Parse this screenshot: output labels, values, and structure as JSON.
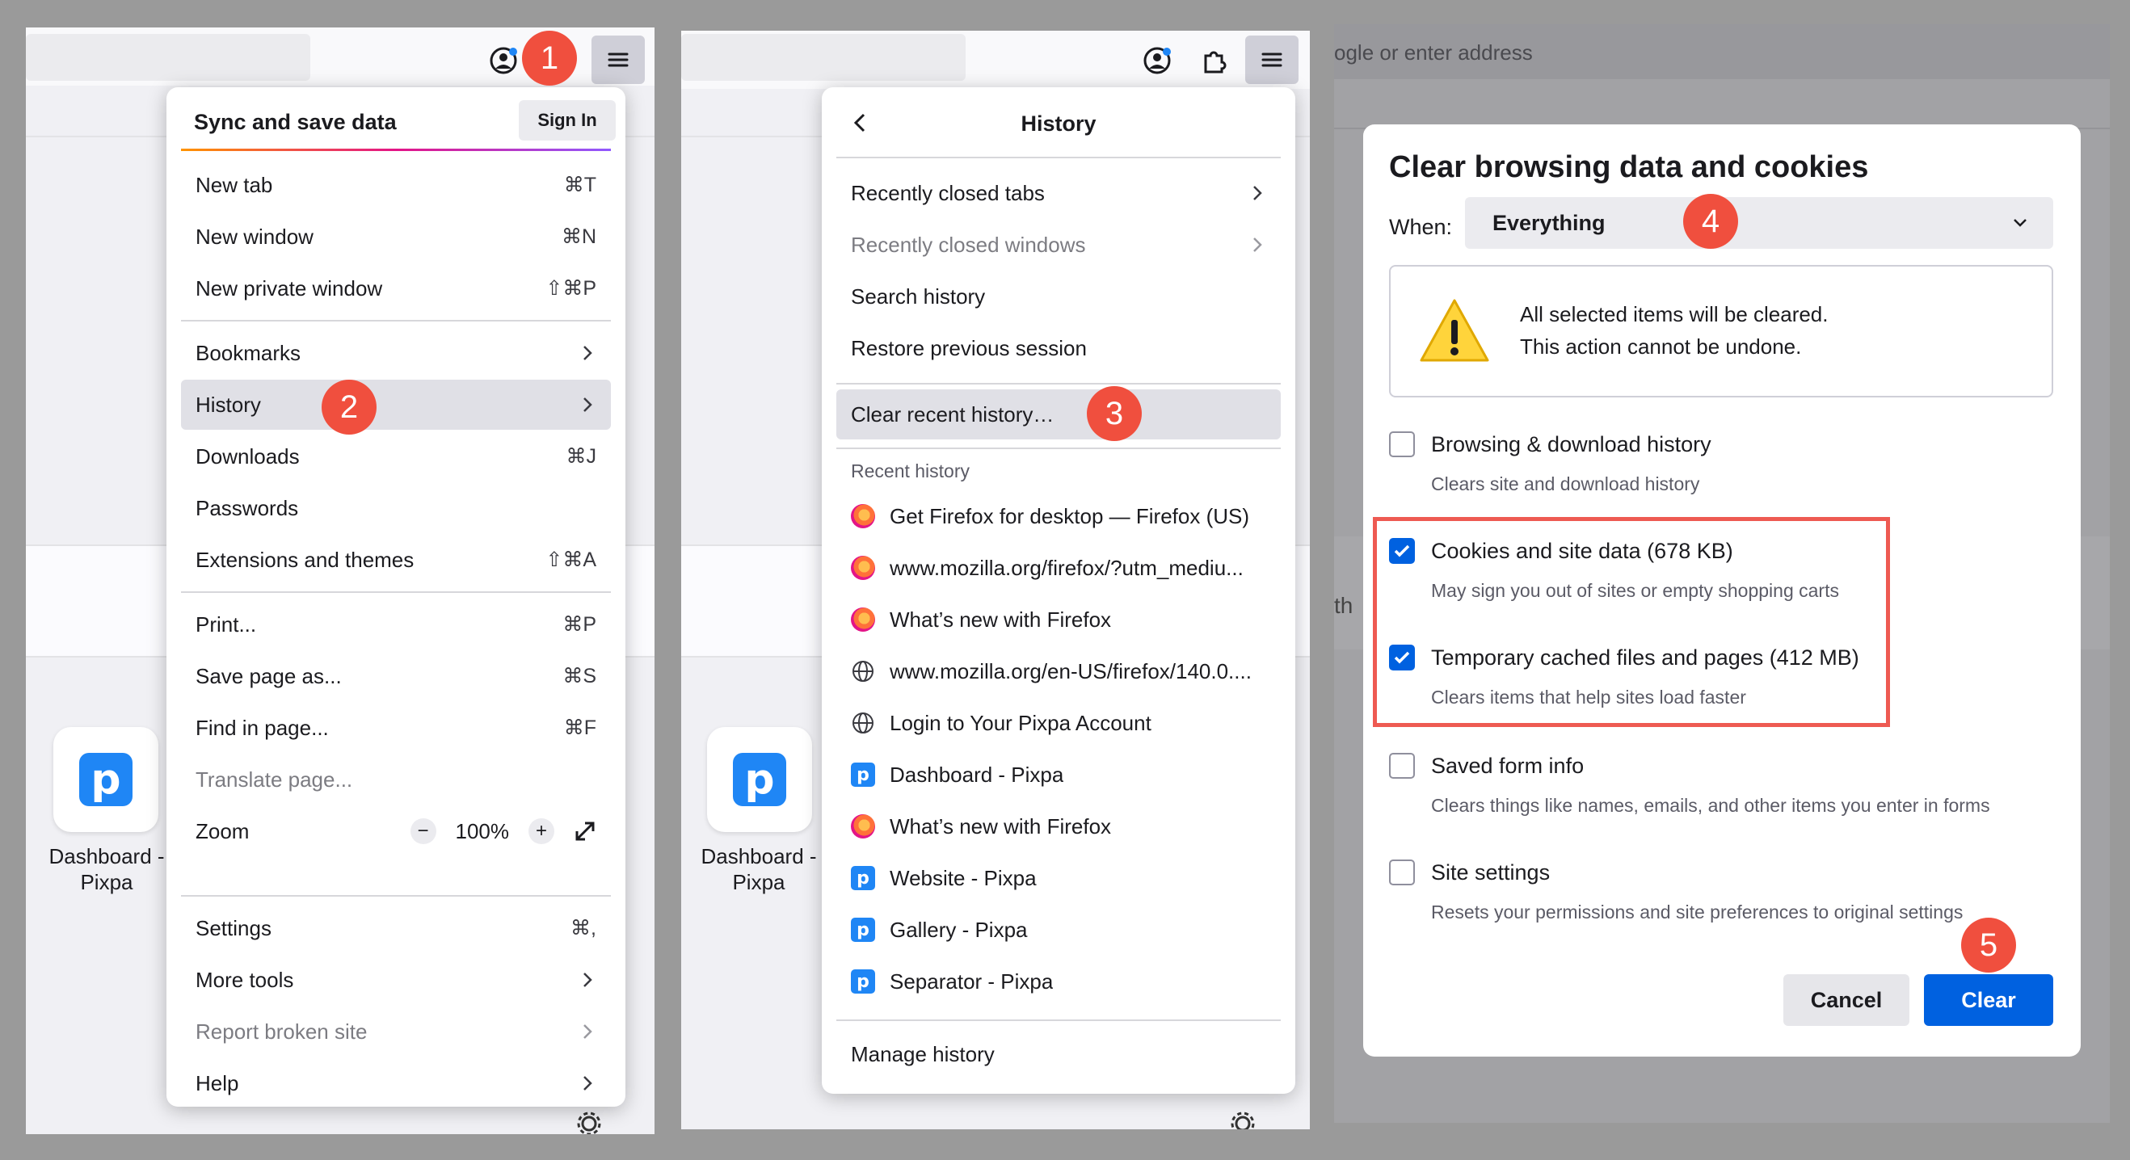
{
  "panel1": {
    "tile_label": "Dashboard - Pixpa",
    "tile_logo": "p",
    "menu": {
      "sync_title": "Sync and save data",
      "sign_in": "Sign In",
      "items": [
        {
          "label": "New tab",
          "shortcut": "⌘T"
        },
        {
          "label": "New window",
          "shortcut": "⌘N"
        },
        {
          "label": "New private window",
          "shortcut": "⇧⌘P"
        },
        {
          "label": "Bookmarks",
          "shortcut": ""
        },
        {
          "label": "History",
          "shortcut": ""
        },
        {
          "label": "Downloads",
          "shortcut": "⌘J"
        },
        {
          "label": "Passwords",
          "shortcut": ""
        },
        {
          "label": "Extensions and themes",
          "shortcut": "⇧⌘A"
        },
        {
          "label": "Print...",
          "shortcut": "⌘P"
        },
        {
          "label": "Save page as...",
          "shortcut": "⌘S"
        },
        {
          "label": "Find in page...",
          "shortcut": "⌘F"
        },
        {
          "label": "Translate page...",
          "shortcut": ""
        },
        {
          "label": "Zoom",
          "shortcut": ""
        },
        {
          "label": "Settings",
          "shortcut": "⌘,"
        },
        {
          "label": "More tools",
          "shortcut": ""
        },
        {
          "label": "Report broken site",
          "shortcut": ""
        },
        {
          "label": "Help",
          "shortcut": ""
        }
      ],
      "zoom_minus": "−",
      "zoom_value": "100%",
      "zoom_plus": "+"
    }
  },
  "panel2": {
    "tile_label": "Dashboard - Pixpa",
    "tile_logo": "p",
    "menu": {
      "title": "History",
      "items": [
        "Recently closed tabs",
        "Recently closed windows",
        "Search history",
        "Restore previous session",
        "Clear recent history…"
      ],
      "recent_header": "Recent history",
      "recent": [
        {
          "label": "Get Firefox for desktop — Firefox (US)",
          "icon": "firefox-icon"
        },
        {
          "label": "www.mozilla.org/firefox/?utm_mediu...",
          "icon": "firefox-icon"
        },
        {
          "label": "What’s new with Firefox",
          "icon": "firefox-icon"
        },
        {
          "label": "www.mozilla.org/en-US/firefox/140.0....",
          "icon": "globe-icon"
        },
        {
          "label": "Login to Your Pixpa Account",
          "icon": "globe-icon"
        },
        {
          "label": "Dashboard - Pixpa",
          "icon": "pixpa-icon"
        },
        {
          "label": "What’s new with Firefox",
          "icon": "firefox-icon"
        },
        {
          "label": "Website - Pixpa",
          "icon": "pixpa-icon"
        },
        {
          "label": "Gallery - Pixpa",
          "icon": "pixpa-icon"
        },
        {
          "label": "Separator - Pixpa",
          "icon": "pixpa-icon"
        }
      ],
      "manage": "Manage history"
    }
  },
  "panel3": {
    "address_placeholder": "ogle or enter address",
    "side_text": "th",
    "dialog": {
      "title": "Clear browsing data and cookies",
      "when_label": "When:",
      "when_value": "Everything",
      "warning_line1": "All selected items will be cleared.",
      "warning_line2": "This action cannot be undone.",
      "options": [
        {
          "label": "Browsing & download history",
          "desc": "Clears site and download history",
          "checked": false
        },
        {
          "label": "Cookies and site data (678 KB)",
          "desc": "May sign you out of sites or empty shopping carts",
          "checked": true
        },
        {
          "label": "Temporary cached files and pages (412 MB)",
          "desc": "Clears items that help sites load faster",
          "checked": true
        },
        {
          "label": "Saved form info",
          "desc": "Clears things like names, emails, and other items you enter in forms",
          "checked": false
        },
        {
          "label": "Site settings",
          "desc": "Resets your permissions and site preferences to original settings",
          "checked": false
        }
      ],
      "cancel": "Cancel",
      "clear": "Clear"
    }
  },
  "badges": [
    "1",
    "2",
    "3",
    "4",
    "5"
  ],
  "colors": {
    "badge": "#f04f3e",
    "accent": "#0061e0",
    "highlight_box": "#ee5a52"
  }
}
